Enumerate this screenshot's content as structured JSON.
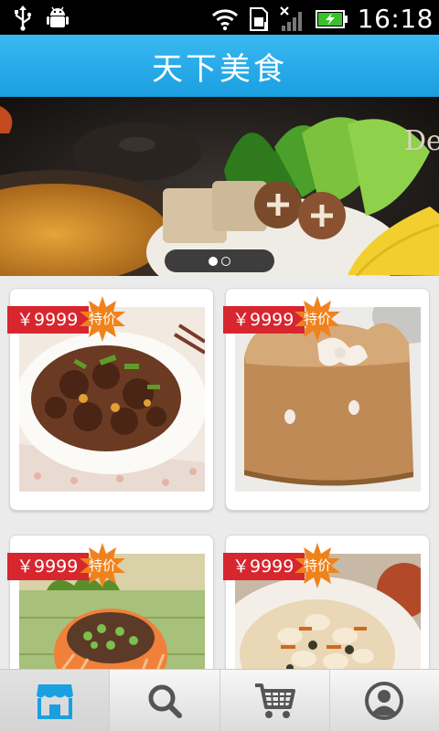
{
  "status_bar": {
    "time": "16:18",
    "icons_left": [
      "usb-icon",
      "android-debug-icon"
    ],
    "icons_right": [
      "wifi-icon",
      "sim-icon",
      "no-signal-icon",
      "battery-charging-icon"
    ]
  },
  "header": {
    "title": "天下美食"
  },
  "banner": {
    "slide_count": 2,
    "active_slide": 1,
    "partial_text": "De"
  },
  "products": [
    {
      "price": "￥9999",
      "badge": "特价",
      "image": "braised-beef-dish"
    },
    {
      "price": "￥9999",
      "badge": "特价",
      "image": "hello-kitty-jelly"
    },
    {
      "price": "￥9999",
      "badge": "特价",
      "image": "stuffed-papaya-dish"
    },
    {
      "price": "￥9999",
      "badge": "特价",
      "image": "seafood-stir-fry"
    }
  ],
  "tabbar": {
    "items": [
      "store-icon",
      "search-icon",
      "cart-icon",
      "profile-icon"
    ],
    "active": 0
  },
  "colors": {
    "header_blue": "#1a9fe0",
    "price_red": "#d7262e",
    "badge_orange": "#f08a1c",
    "tab_active_icon": "#1a9fe0",
    "tab_icon": "#555555"
  }
}
